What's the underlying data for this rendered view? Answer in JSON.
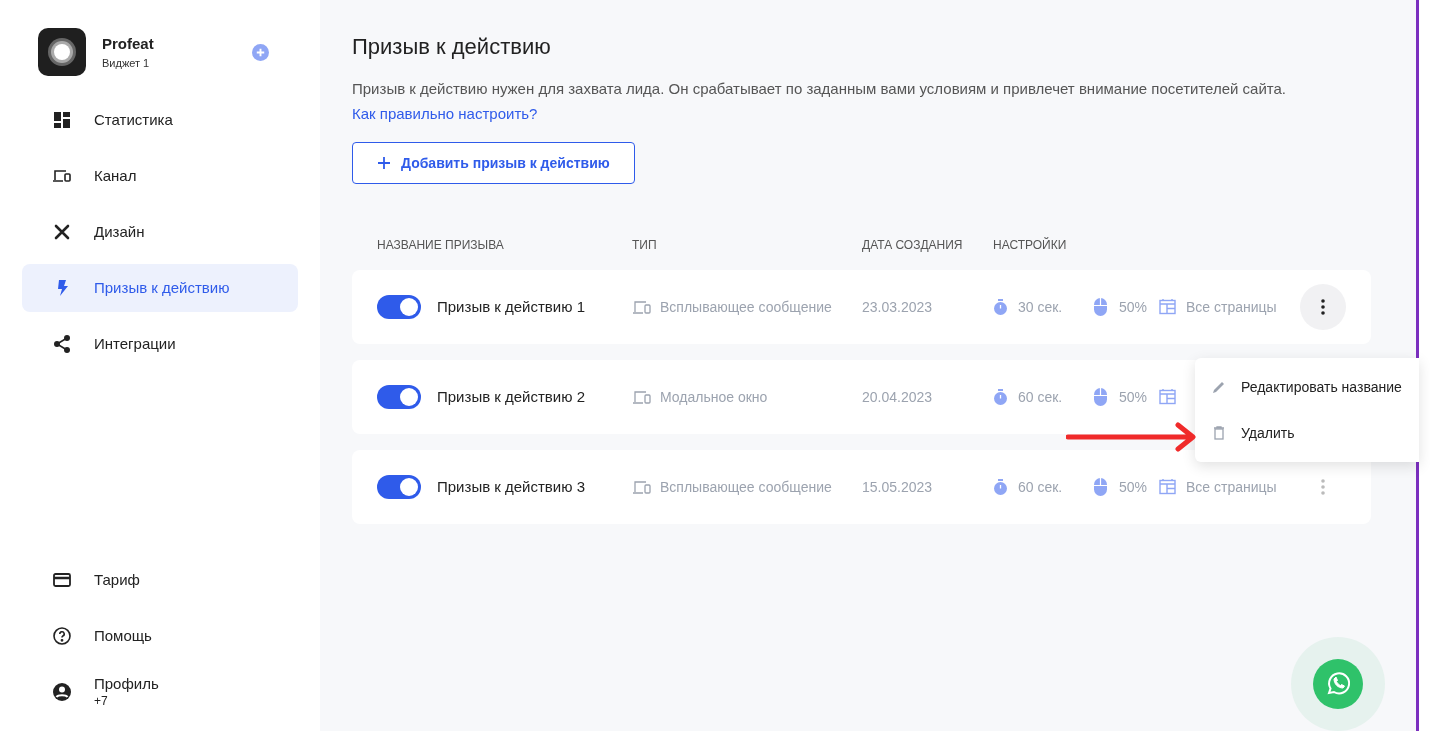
{
  "sidebar": {
    "brand": {
      "name": "Profeat",
      "subtitle": "Виджет 1"
    },
    "items": [
      {
        "label": "Статистика",
        "kind": "grid",
        "selected": false
      },
      {
        "label": "Канал",
        "kind": "devices",
        "selected": false
      },
      {
        "label": "Дизайн",
        "kind": "tools",
        "selected": false
      },
      {
        "label": "Призыв к действию",
        "kind": "bolt",
        "selected": true
      },
      {
        "label": "Интеграции",
        "kind": "share",
        "selected": false
      }
    ],
    "bottom_items": [
      {
        "label": "Тариф",
        "kind": "card"
      },
      {
        "label": "Помощь",
        "kind": "help"
      },
      {
        "label": "Профиль",
        "sublabel": "+7",
        "kind": "user"
      }
    ]
  },
  "page": {
    "title": "Призыв к действию",
    "description": "Призыв к действию нужен для захвата лида. Он срабатывает по заданным вами условиям и привлечет внимание посетителей сайта.",
    "help_link": "Как правильно настроить?",
    "add_button": "Добавить призыв к действию"
  },
  "table": {
    "columns": [
      "НАЗВАНИЕ ПРИЗЫВА",
      "ТИП",
      "ДАТА СОЗДАНИЯ",
      "НАСТРОЙКИ"
    ],
    "rows": [
      {
        "on": true,
        "name": "Призыв к действию 1",
        "type": "Всплывающее сообщение",
        "date": "23.03.2023",
        "delay": "30 сек.",
        "scroll": "50%",
        "pages": "Все страницы",
        "menu_open": true
      },
      {
        "on": true,
        "name": "Призыв к действию 2",
        "type": "Модальное окно",
        "date": "20.04.2023",
        "delay": "60 сек.",
        "scroll": "50%"
      },
      {
        "on": true,
        "name": "Призыв к действию 3",
        "type": "Всплывающее сообщение",
        "date": "15.05.2023",
        "delay": "60 сек.",
        "scroll": "50%",
        "pages": "Все страницы",
        "menu_open": false
      }
    ]
  },
  "context_menu": {
    "items": [
      {
        "label": "Редактировать название",
        "kind": "edit"
      },
      {
        "label": "Удалить",
        "kind": "trash"
      }
    ]
  }
}
